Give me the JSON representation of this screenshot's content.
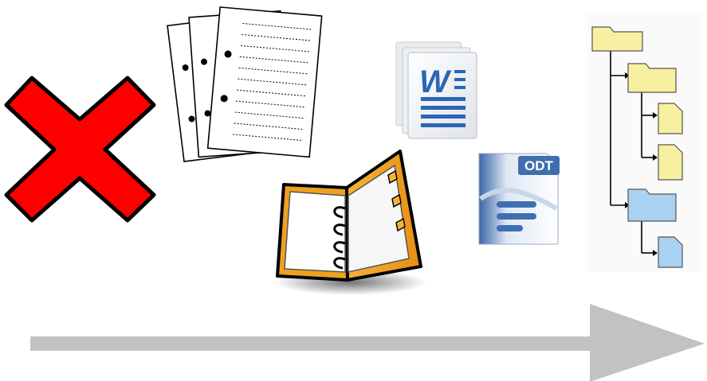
{
  "icons": {
    "cross": "red-cross-icon",
    "papers": "loose-paper-sheets-icon",
    "word": "word-document-icon",
    "binder": "ring-binder-icon",
    "odt": "odt-document-icon",
    "tree": "folder-tree-icon",
    "arrow": "progress-arrow-icon"
  },
  "labels": {
    "word_letter": "W",
    "odt_badge": "ODT"
  },
  "colors": {
    "cross": "#ff0000",
    "folder_yellow": "#f7f0a0",
    "folder_blue": "#a9d1f2",
    "arrow": "#c2c2c2",
    "word_blue": "#2a66b5",
    "odt_blue": "#3f6fb0",
    "binder_orange": "#f2a92a"
  }
}
